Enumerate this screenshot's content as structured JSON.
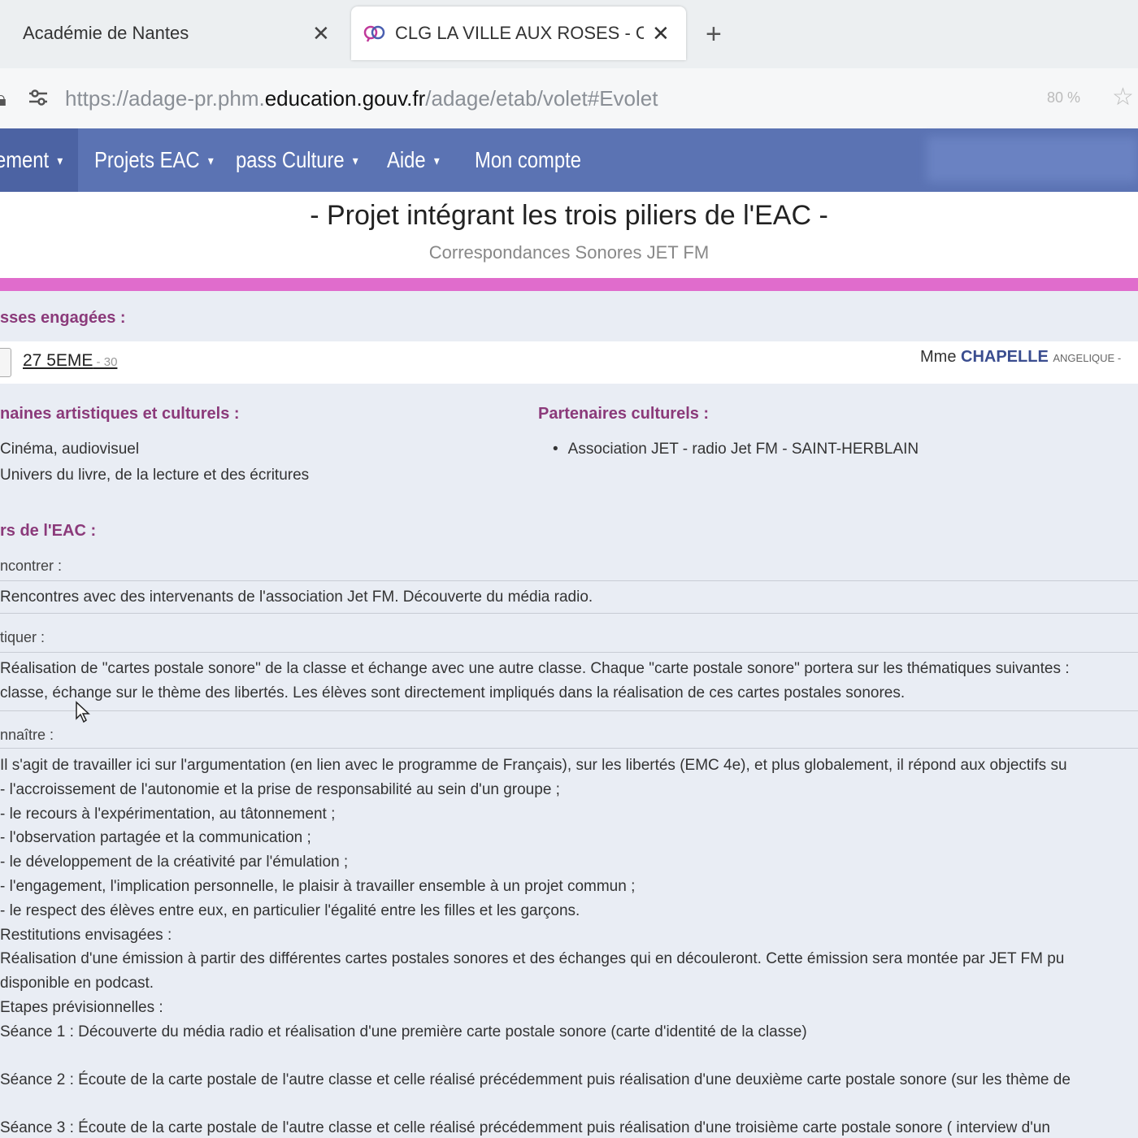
{
  "browser": {
    "tabs": [
      {
        "title": "Académie de Nantes",
        "close_glyph": "✕"
      },
      {
        "title": "CLG LA VILLE AUX ROSES - CH/",
        "close_glyph": "✕",
        "active": true
      }
    ],
    "new_tab_glyph": "+",
    "url": {
      "prefix": "https://adage-pr.phm.",
      "domain": "education.gouv.fr",
      "path": "/adage/etab/volet#Evolet"
    },
    "zoom": "80 %",
    "icons": [
      "lock-icon",
      "page-settings-icon",
      "bookmark-star-icon"
    ]
  },
  "nav": {
    "items": [
      "ement",
      "Projets EAC",
      "pass Culture",
      "Aide",
      "Mon compte"
    ],
    "caret": "▾",
    "active_color": "#4c63a3",
    "bg_color": "#5b73b3"
  },
  "project": {
    "title": "- Projet intégrant les trois piliers de l'EAC -",
    "subtitle": "Correspondances Sonores JET FM",
    "accent_color": "#e06ccc"
  },
  "classes": {
    "heading": "sses engagées :",
    "name": "27 5EME",
    "count": " - 30",
    "teacher_title": "Mme",
    "teacher_name": "CHAPELLE",
    "teacher_firstname": "ANGELIQUE - "
  },
  "domaines": {
    "heading": "naines artistiques et culturels :",
    "items": [
      "Cinéma, audiovisuel",
      "Univers du livre, de la lecture et des écritures"
    ]
  },
  "partenaires": {
    "heading": "Partenaires culturels :",
    "items": [
      "Association JET - radio Jet FM - SAINT-HERBLAIN"
    ]
  },
  "piliers": {
    "heading": "rs de l'EAC :",
    "rencontrer": {
      "label": "ncontrer :",
      "text": "Rencontres avec des intervenants de l'association Jet FM. Découverte du média radio."
    },
    "pratiquer": {
      "label": "tiquer :",
      "lines": [
        "Réalisation de \"cartes postale sonore\" de la classe et échange avec une autre classe. Chaque \"carte postale sonore\" portera sur les thématiques suivantes :",
        "classe, échange sur le thème des libertés. Les élèves sont directement impliqués dans la réalisation de ces cartes postales sonores."
      ]
    },
    "connaitre": {
      "label": "nnaître :",
      "lines": [
        "Il s'agit de travailler ici sur l'argumentation (en lien avec le programme de Français), sur les libertés (EMC 4e), et plus globalement, il répond aux objectifs su",
        "- l'accroissement de l'autonomie et la prise de responsabilité au sein d'un groupe ;",
        "- le recours à l'expérimentation, au tâtonnement ;",
        "- l'observation partagée et la communication ;",
        "- le développement de la créativité par l'émulation ;",
        "- l'engagement, l'implication personnelle, le plaisir à travailler ensemble à un projet commun ;",
        "- le respect des élèves entre eux, en particulier l'égalité entre les filles et les garçons.",
        "Restitutions envisagées :",
        "Réalisation d'une émission à partir des différentes cartes postales sonores et des échanges qui en découleront. Cette émission sera montée par JET FM pu",
        "disponible en podcast.",
        "Etapes prévisionnelles :",
        "Séance 1 : Découverte du média radio et réalisation d'une première carte postale sonore (carte d'identité de la classe)"
      ],
      "seances": [
        "Séance 2 : Écoute de la carte postale de l'autre classe et celle réalisé précédemment puis réalisation d'une deuxième carte postale sonore (sur les thème de",
        "Séance 3 : Écoute de la carte postale de l'autre classe et celle réalisé précédemment puis réalisation d'une troisième carte postale sonore ( interview d'un"
      ]
    }
  }
}
